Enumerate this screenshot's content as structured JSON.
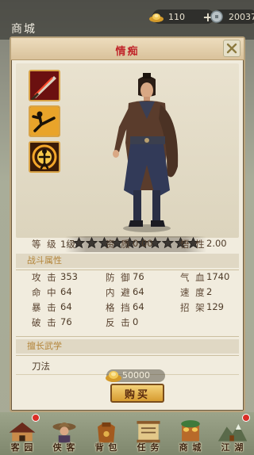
{
  "topbar": {
    "title": "商城",
    "gold": "110",
    "silver": "20037"
  },
  "modal": {
    "title": "情痴",
    "skills": [
      "blade-skill-icon",
      "kick-skill-icon",
      "aura-skill-icon"
    ],
    "stars_total": 10,
    "stars_filled": 0,
    "basic": {
      "level_label": "等 级",
      "level_value": "1级",
      "aptitude_label": "资 质",
      "aptitude_value": "0.00",
      "wisdom_label": "悟 性",
      "wisdom_value": "2.00"
    },
    "combat_section": "战斗属性",
    "combat": [
      [
        {
          "label": "攻 击",
          "value": "353"
        },
        {
          "label": "防 御",
          "value": "76"
        },
        {
          "label": "气 血",
          "value": "1740"
        }
      ],
      [
        {
          "label": "命 中",
          "value": "64"
        },
        {
          "label": "内 避",
          "value": "64"
        },
        {
          "label": "速 度",
          "value": "2"
        }
      ],
      [
        {
          "label": "暴 击",
          "value": "64"
        },
        {
          "label": "格 挡",
          "value": "64"
        },
        {
          "label": "招 架",
          "value": "129"
        }
      ],
      [
        {
          "label": "破 击",
          "value": "76"
        },
        {
          "label": "反 击",
          "value": "0"
        },
        {
          "label": "",
          "value": ""
        }
      ]
    ],
    "martial_section": "擅长武学",
    "martial_value": "刀法",
    "price": "50000",
    "buy_label": "购买"
  },
  "bottom_nav": [
    {
      "label": "客 园",
      "icon": "courtyard-icon",
      "badge": true
    },
    {
      "label": "侠 客",
      "icon": "hero-icon",
      "badge": false
    },
    {
      "label": "背 包",
      "icon": "bag-icon",
      "badge": false
    },
    {
      "label": "任 务",
      "icon": "quest-scroll-icon",
      "badge": false
    },
    {
      "label": "商 城",
      "icon": "shop-icon",
      "badge": false
    },
    {
      "label": "江 湖",
      "icon": "world-icon",
      "badge": true
    }
  ],
  "colors": {
    "title_red": "#c0262b",
    "section_gold": "#b3853a",
    "button_gold": "#e3b04d"
  }
}
